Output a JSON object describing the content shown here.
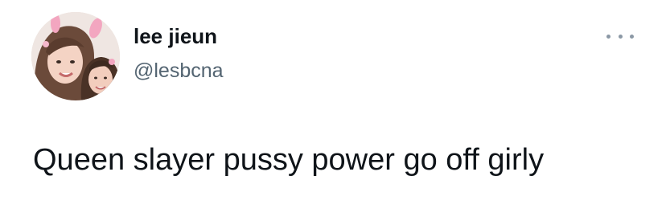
{
  "tweet": {
    "author": {
      "display_name": "lee jieun",
      "handle": "@lesbcna",
      "avatar_icon": "profile-photo"
    },
    "text": "Queen slayer pussy power go off girly",
    "more_icon": "more-horizontal-icon"
  },
  "colors": {
    "primary_text": "#0f1419",
    "secondary_text": "#536471",
    "background": "#ffffff"
  }
}
